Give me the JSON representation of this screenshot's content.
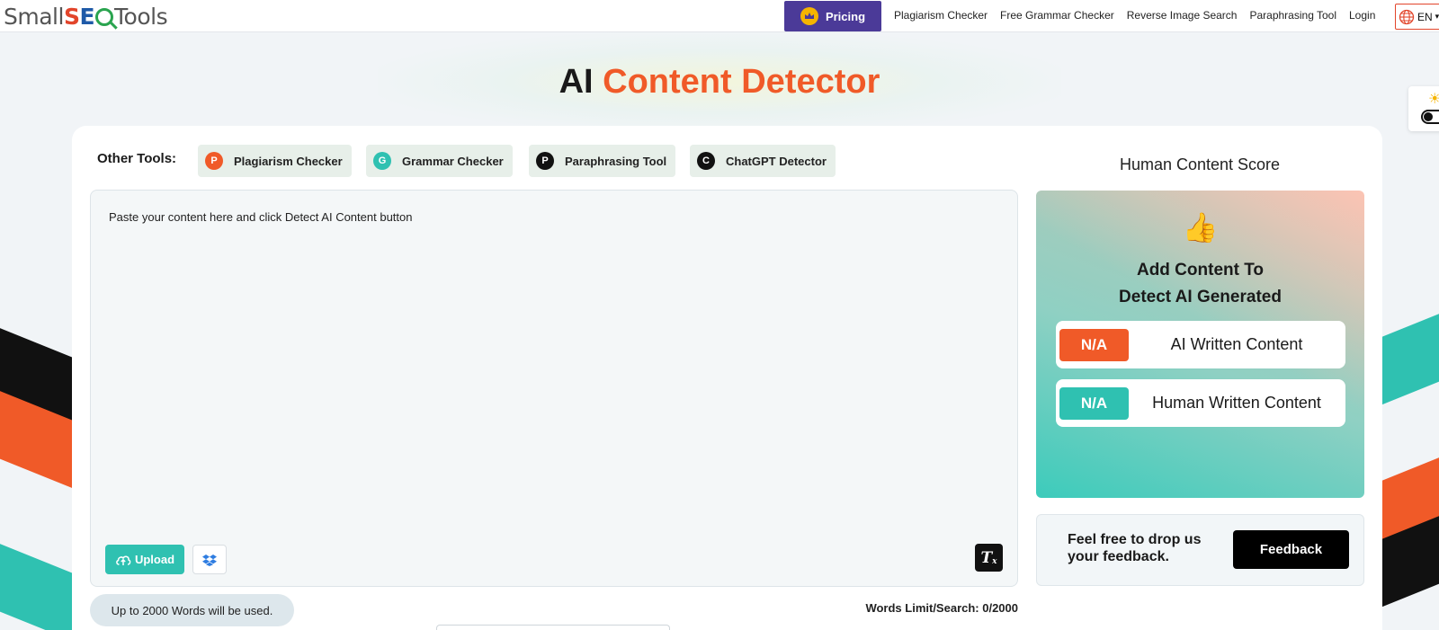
{
  "header": {
    "logo": {
      "part1": "Small",
      "s": "S",
      "e": "E",
      "part2": "Tools"
    },
    "pricing_label": "Pricing",
    "nav_links": [
      "Plagiarism Checker",
      "Free Grammar Checker",
      "Reverse Image Search",
      "Paraphrasing Tool",
      "Login"
    ],
    "language": "EN"
  },
  "page": {
    "title_prefix": "AI",
    "title_accent": "Content Detector"
  },
  "other_tools": {
    "label": "Other Tools:",
    "items": [
      {
        "letter": "P",
        "label": "Plagiarism Checker",
        "color": "#f05a28"
      },
      {
        "letter": "G",
        "label": "Grammar Checker",
        "color": "#2fc1b1"
      },
      {
        "letter": "P",
        "label": "Paraphrasing Tool",
        "color": "#111111"
      },
      {
        "letter": "C",
        "label": "ChatGPT Detector",
        "color": "#111111"
      }
    ]
  },
  "editor": {
    "placeholder": "Paste your content here and click Detect AI Content button",
    "upload_label": "Upload",
    "words_used_note": "Up to 2000 Words will be used.",
    "words_limit": "Words Limit/Search: 0/2000"
  },
  "score": {
    "title": "Human Content Score",
    "heading_line1": "Add Content To",
    "heading_line2": "Detect AI Generated",
    "ai": {
      "value": "N/A",
      "label": "AI Written Content",
      "color": "#f05a28"
    },
    "human": {
      "value": "N/A",
      "label": "Human Written Content",
      "color": "#2fc1b1"
    }
  },
  "feedback": {
    "text": "Feel free to drop us your feedback.",
    "button": "Feedback"
  }
}
